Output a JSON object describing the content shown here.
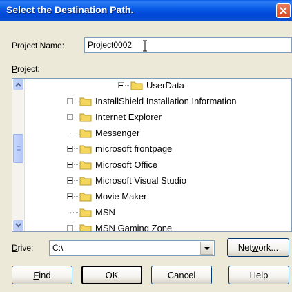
{
  "window": {
    "title": "Select the Destination Path."
  },
  "project_name": {
    "label": "Project Name:",
    "value": "Project0002"
  },
  "project": {
    "label": "Project:",
    "tree_items": [
      {
        "label": "UserData",
        "expandable": true
      },
      {
        "label": "InstallShield Installation Information",
        "expandable": true
      },
      {
        "label": "Internet Explorer",
        "expandable": true
      },
      {
        "label": "Messenger",
        "expandable": false
      },
      {
        "label": "microsoft frontpage",
        "expandable": true
      },
      {
        "label": "Microsoft Office",
        "expandable": true
      },
      {
        "label": "Microsoft Visual Studio",
        "expandable": true
      },
      {
        "label": "Movie Maker",
        "expandable": true
      },
      {
        "label": "MSN",
        "expandable": false
      },
      {
        "label": "MSN Gaming Zone",
        "expandable": true
      }
    ]
  },
  "drive": {
    "label": "Drive:",
    "value": "C:\\"
  },
  "buttons": {
    "network": "Network...",
    "find": "Find",
    "ok": "OK",
    "cancel": "Cancel",
    "help": "Help"
  },
  "colors": {
    "title_bar": "#0a5ce8",
    "close_button": "#d84822",
    "dialog_bg": "#ece9d8",
    "folder": "#f5d65c"
  }
}
